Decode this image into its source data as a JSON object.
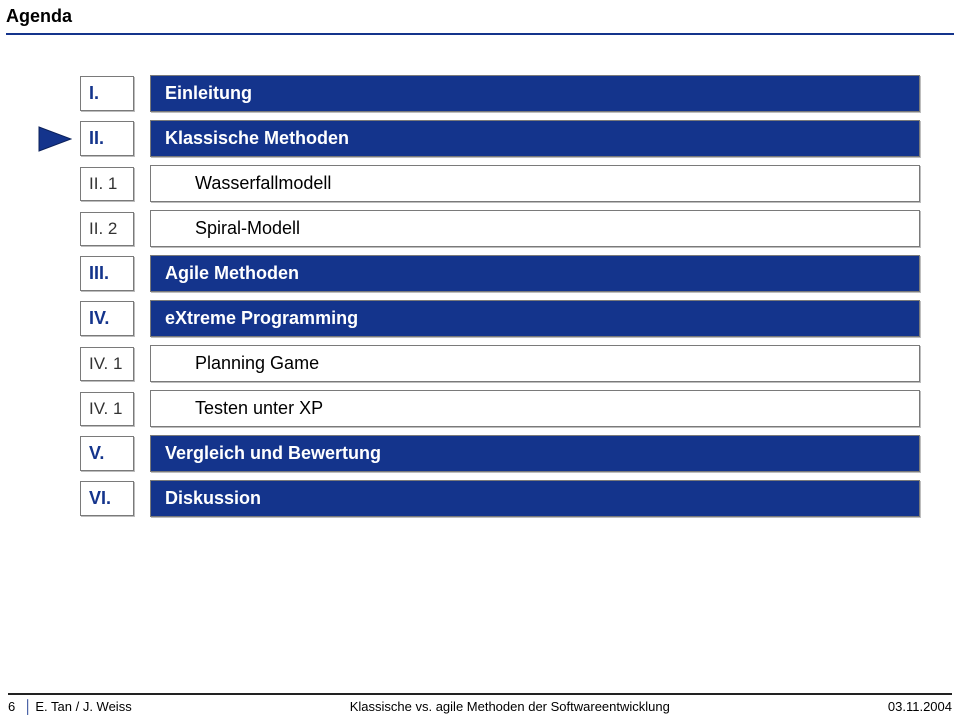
{
  "title": "Agenda",
  "current_row": 1,
  "rows": [
    {
      "num": "I.",
      "label": "Einleitung",
      "level": 0
    },
    {
      "num": "II.",
      "label": "Klassische Methoden",
      "level": 0
    },
    {
      "num": "II. 1",
      "label": "Wasserfallmodell",
      "level": 1
    },
    {
      "num": "II. 2",
      "label": "Spiral-Modell",
      "level": 1
    },
    {
      "num": "III.",
      "label": "Agile Methoden",
      "level": 0
    },
    {
      "num": "IV.",
      "label": "eXtreme Programming",
      "level": 0
    },
    {
      "num": "IV. 1",
      "label": "Planning Game",
      "level": 1
    },
    {
      "num": "IV. 1",
      "label": "Testen unter XP",
      "level": 1
    },
    {
      "num": "V.",
      "label": "Vergleich und Bewertung",
      "level": 0
    },
    {
      "num": "VI.",
      "label": "Diskussion",
      "level": 0
    }
  ],
  "footer": {
    "page_number": "6",
    "authors": "E. Tan / J. Weiss",
    "center": "Klassische vs. agile Methoden der Softwareentwicklung",
    "date": "03.11.2004"
  },
  "colors": {
    "brand_blue": "#14348c"
  }
}
